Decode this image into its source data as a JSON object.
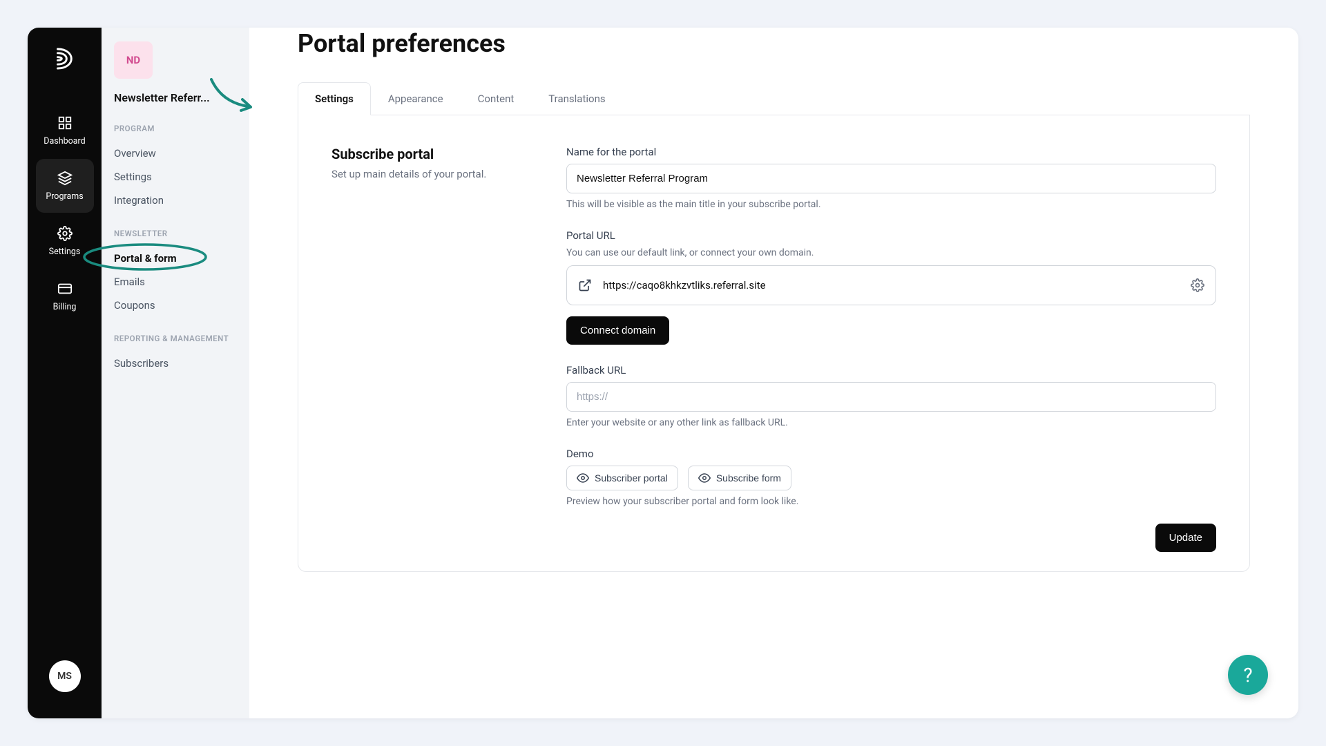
{
  "rail": {
    "items": [
      {
        "label": "Dashboard"
      },
      {
        "label": "Programs"
      },
      {
        "label": "Settings"
      },
      {
        "label": "Billing"
      }
    ],
    "avatar": "MS"
  },
  "sidebar": {
    "badge": "ND",
    "program_name": "Newsletter Referr...",
    "sections": {
      "program": {
        "label": "PROGRAM",
        "items": [
          "Overview",
          "Settings",
          "Integration"
        ]
      },
      "newsletter": {
        "label": "NEWSLETTER",
        "items": [
          "Portal & form",
          "Emails",
          "Coupons"
        ]
      },
      "reporting": {
        "label": "REPORTING & MANAGEMENT",
        "items": [
          "Subscribers"
        ]
      }
    }
  },
  "main": {
    "title": "Portal preferences",
    "tabs": [
      "Settings",
      "Appearance",
      "Content",
      "Translations"
    ],
    "section": {
      "title": "Subscribe portal",
      "desc": "Set up main details of your portal."
    },
    "portal_name": {
      "label": "Name for the portal",
      "value": "Newsletter Referral Program",
      "hint": "This will be visible as the main title in your subscribe portal."
    },
    "portal_url": {
      "label": "Portal URL",
      "sublabel": "You can use our default link, or connect your own domain.",
      "value": "https://caqo8khkzvtliks.referral.site",
      "connect_btn": "Connect domain"
    },
    "fallback": {
      "label": "Fallback URL",
      "placeholder": "https://",
      "hint": "Enter your website or any other link as fallback URL."
    },
    "demo": {
      "label": "Demo",
      "btn1": "Subscriber portal",
      "btn2": "Subscribe form",
      "hint": "Preview how your subscriber portal and form look like."
    },
    "update_btn": "Update"
  }
}
